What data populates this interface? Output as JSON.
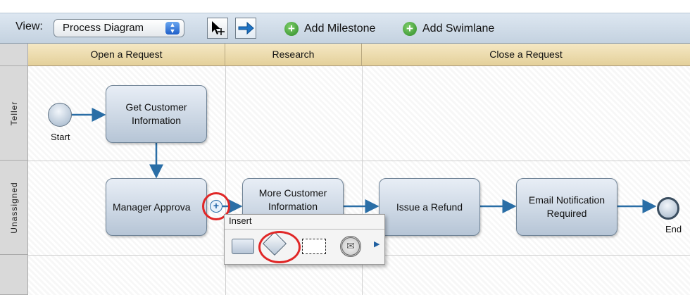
{
  "toolbar": {
    "view_label": "View:",
    "view_select_value": "Process Diagram",
    "add_milestone_label": "Add Milestone",
    "add_swimlane_label": "Add Swimlane",
    "tool_icons": [
      "select-pointer-icon",
      "connector-arrow-icon"
    ]
  },
  "milestones": [
    "Open a Request",
    "Research",
    "Close a Request"
  ],
  "lanes": [
    "Teller",
    "Unassigned"
  ],
  "tasks": {
    "get_customer": "Get Customer Information",
    "manager": "Manager Approva",
    "more_customer": "More Customer Information",
    "refund": "Issue a Refund",
    "email": "Email Notification Required"
  },
  "events": {
    "start": "Start",
    "end": "End"
  },
  "insert_popup": {
    "title": "Insert",
    "items": [
      "task-icon",
      "gateway-icon",
      "subprocess-icon",
      "intermediate-event-icon",
      "more-arrow-icon"
    ]
  },
  "colors": {
    "connector": "#2a6ea6",
    "highlight_ring": "#e02727",
    "milestone_header": "#ecdcb0",
    "task_fill": "#c6d3e2"
  }
}
